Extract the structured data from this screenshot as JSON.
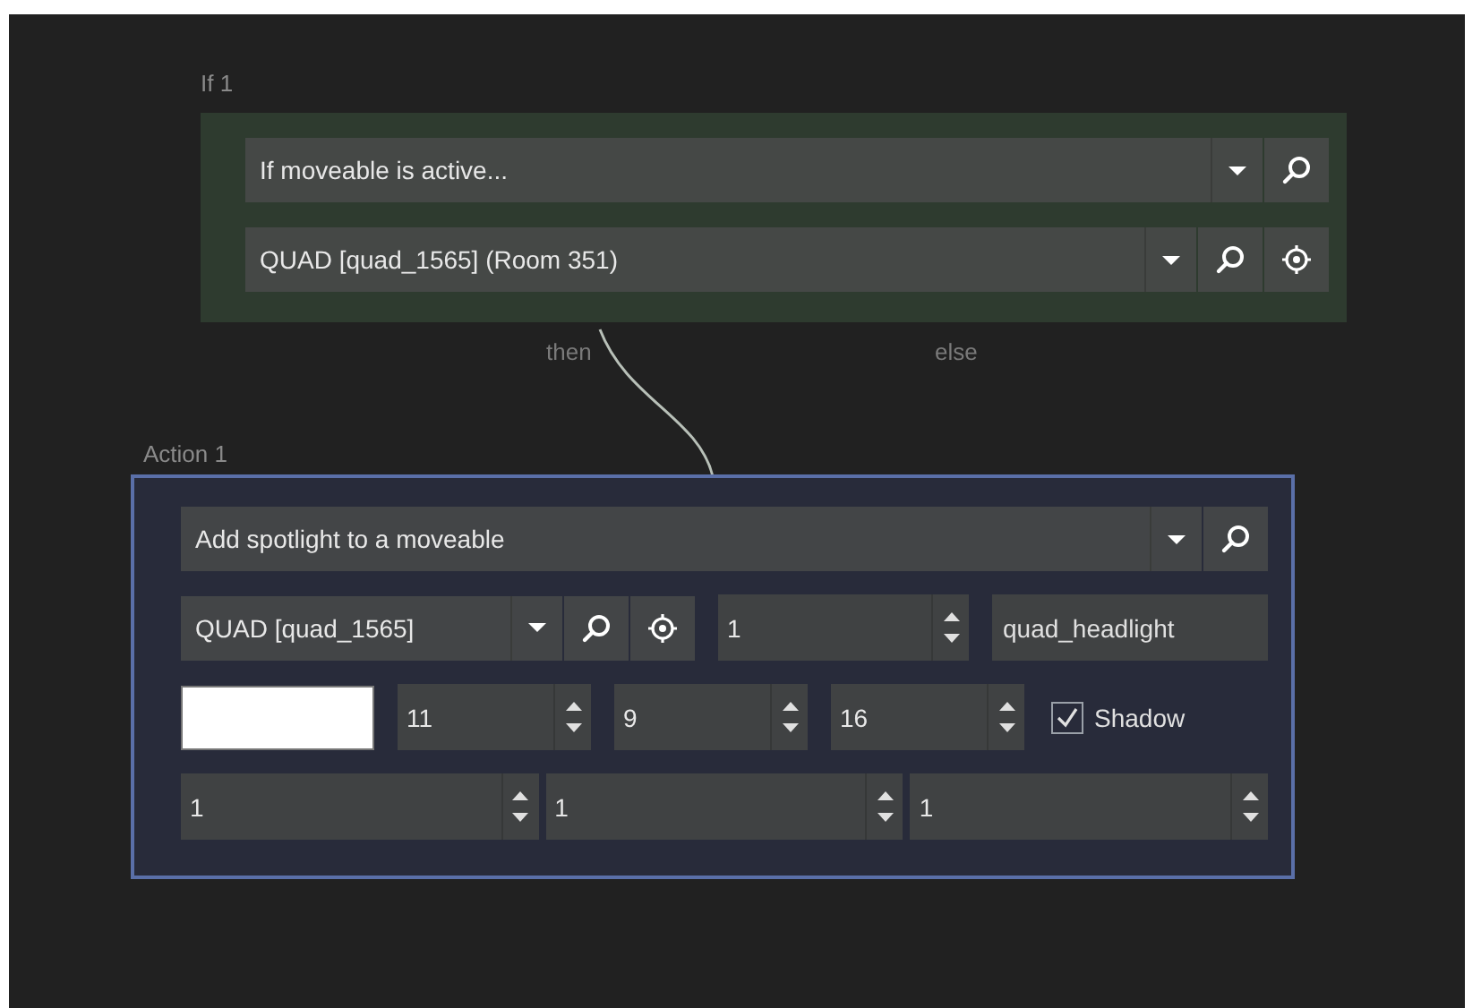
{
  "if_node": {
    "title": "If 1",
    "condition": {
      "value": "If moveable is active..."
    },
    "target": {
      "value": "QUAD [quad_1565] (Room 351)"
    },
    "branches": [
      {
        "label": "then"
      },
      {
        "label": "else"
      }
    ]
  },
  "action_node": {
    "title": "Action 1",
    "action": {
      "value": "Add spotlight to a moveable"
    },
    "moveable": {
      "value": "QUAD [quad_1565]"
    },
    "index_spinner": {
      "value": "1"
    },
    "name_field": {
      "value": "quad_headlight"
    },
    "color_swatch": {
      "color": "#ffffff"
    },
    "color_spinners": [
      {
        "value": "11"
      },
      {
        "value": "9"
      },
      {
        "value": "16"
      }
    ],
    "shadow": {
      "label": "Shadow",
      "checked": true
    },
    "bottom_spinners": [
      {
        "value": "1"
      },
      {
        "value": "1"
      },
      {
        "value": "1"
      }
    ]
  }
}
